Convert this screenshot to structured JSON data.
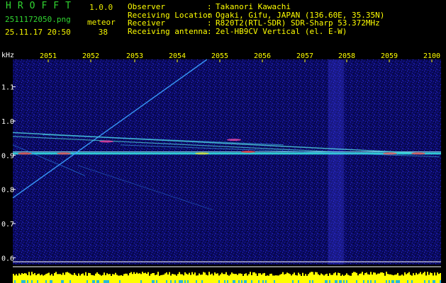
{
  "header": {
    "app_name": "HROFFT",
    "app_version": "1.0.0",
    "file_name": "2511172050.png",
    "meteor_label": "meteor",
    "meteor_count": "38",
    "timestamp": "25.11.17 20:50"
  },
  "info": [
    {
      "key": "Observer",
      "value": "Takanori Kawachi"
    },
    {
      "key": "Receiving Location",
      "value": "Ogaki, Gifu, JAPAN (136.60E, 35.35N)"
    },
    {
      "key": "Receiver",
      "value": "R820T2(RTL-SDR) SDR-Sharp 53.372MHz"
    },
    {
      "key": "Receiving antenna",
      "value": "2el-HB9CV Vertical (el. E-W)"
    }
  ],
  "axis": {
    "unit": "kHz",
    "time_ticks": [
      "2051",
      "2052",
      "2053",
      "2054",
      "2055",
      "2056",
      "2057",
      "2058",
      "2059",
      "2100"
    ],
    "freq_ticks": [
      "1.1",
      "1.0",
      "0.9",
      "0.8",
      "0.7",
      "0.6"
    ],
    "freq_range": [
      0.58,
      1.18
    ]
  },
  "colors": {
    "background": "#000000",
    "noise": "#1a1ab0",
    "tick_label": "#ffff00",
    "signal": "#35e0e0",
    "power_bar": "#ffff00",
    "power_fill": "#25b8d8"
  }
}
